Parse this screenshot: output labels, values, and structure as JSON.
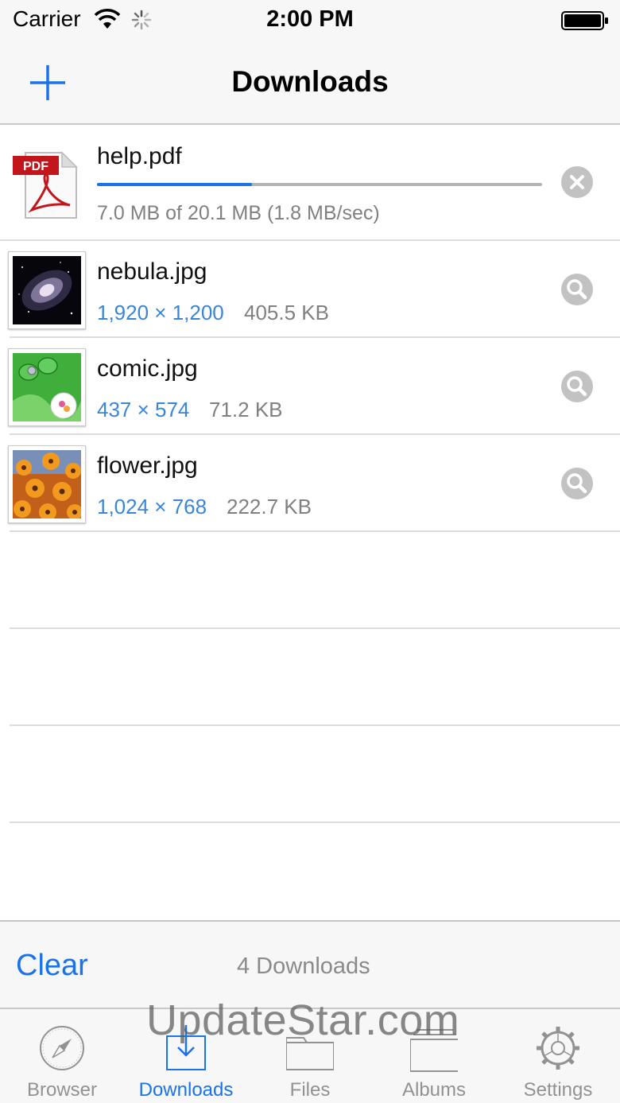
{
  "status_bar": {
    "carrier": "Carrier",
    "time": "2:00 PM",
    "icons": [
      "wifi-icon",
      "activity-spinner-icon",
      "battery-icon"
    ]
  },
  "nav": {
    "title": "Downloads",
    "add_icon": "plus-icon",
    "accent_color": "#1a73e8"
  },
  "active_download": {
    "name": "help.pdf",
    "progress_text": "7.0 MB of 20.1 MB (1.8 MB/sec)",
    "progress_fraction": 0.348,
    "icon": "pdf-file-icon",
    "action_icon": "cancel-icon"
  },
  "files": [
    {
      "name": "nebula.jpg",
      "dimensions": "1,920 × 1,200",
      "size": "405.5 KB",
      "action_icon": "magnifier-icon"
    },
    {
      "name": "comic.jpg",
      "dimensions": "437 × 574",
      "size": "71.2 KB",
      "action_icon": "magnifier-icon"
    },
    {
      "name": "flower.jpg",
      "dimensions": "1,024 × 768",
      "size": "222.7 KB",
      "action_icon": "magnifier-icon"
    }
  ],
  "toolbar": {
    "clear_label": "Clear",
    "count_label": "4 Downloads"
  },
  "tabs": [
    {
      "label": "Browser",
      "icon": "compass-icon",
      "active": false
    },
    {
      "label": "Downloads",
      "icon": "download-tray-icon",
      "active": true
    },
    {
      "label": "Files",
      "icon": "folder-icon",
      "active": false
    },
    {
      "label": "Albums",
      "icon": "album-icon",
      "active": false
    },
    {
      "label": "Settings",
      "icon": "gear-icon",
      "active": false
    }
  ],
  "watermark": "UpdateStar.com"
}
